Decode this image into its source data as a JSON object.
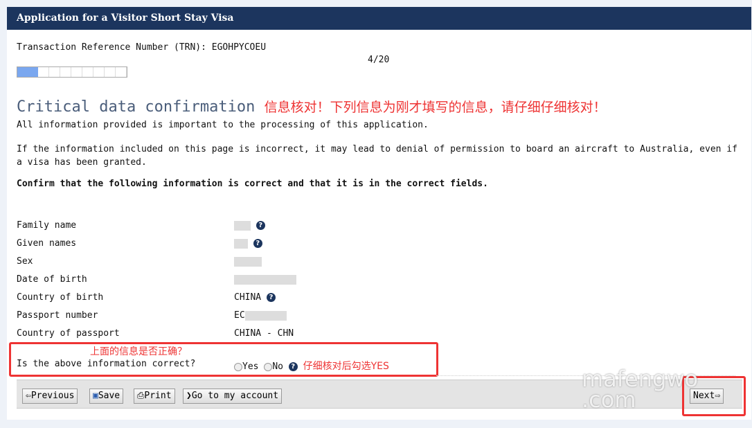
{
  "header": {
    "title": "Application for a Visitor Short Stay Visa"
  },
  "trn": "Transaction Reference Number (TRN): EGOHPYCOEU",
  "progress": {
    "label": "4/20",
    "current": 4,
    "total": 20,
    "fraction": 0.2
  },
  "page": {
    "title": "Critical data confirmation",
    "annotation": "信息核对！下列信息为刚才填写的信息，请仔细仔细核对！",
    "intro": "All information provided is important to the processing of this application.",
    "warning": "If the information included on this page is incorrect, it may lead to denial of permission to board an aircraft to Australia, even if a visa has been granted.",
    "confirm": "Confirm that the following information is correct and that it is in the correct fields."
  },
  "fields": [
    {
      "label": "Family name",
      "value": ""
    },
    {
      "label": "Given names",
      "value": ""
    },
    {
      "label": "Sex",
      "value": ""
    },
    {
      "label": "Date of birth",
      "value": ""
    },
    {
      "label": "Country of birth",
      "value": "CHINA"
    },
    {
      "label": "Passport number",
      "value": "EC"
    },
    {
      "label": "Country of passport",
      "value": "CHINA - CHN"
    }
  ],
  "question": {
    "label": "Is the above information correct?",
    "yes": "Yes",
    "no": "No",
    "annotation_top": "上面的信息是否正确？",
    "annotation_right": "仔细核对后勾选YES"
  },
  "toolbar": {
    "previous": "Previous",
    "save": "Save",
    "print": "Print",
    "account": "Go to my account",
    "next": "Next"
  },
  "watermark": "mafengwo .com",
  "colors": {
    "header": "#1c355e",
    "annotation": "#e33333",
    "progress": "#7aa7ef"
  }
}
